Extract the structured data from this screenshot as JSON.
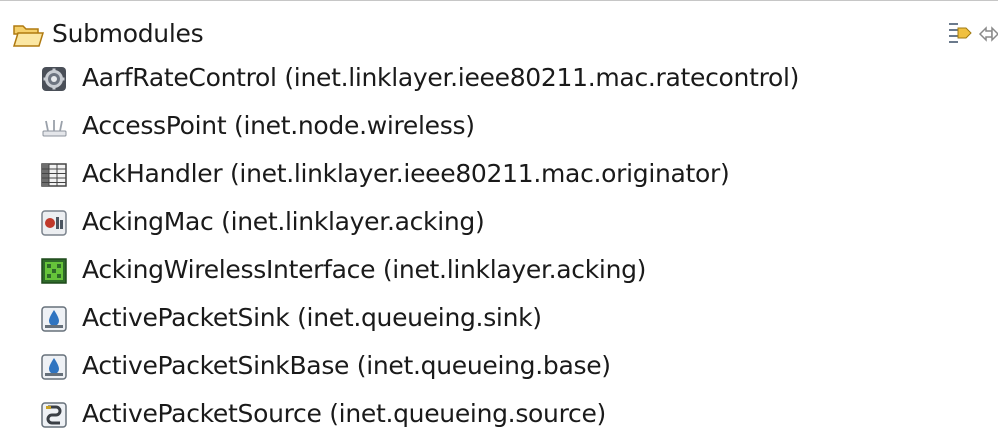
{
  "header": {
    "label": "Submodules",
    "icon": "folder-open-icon",
    "collapse_icon": "collapse-all-icon",
    "link_icon": "link-with-editor-icon"
  },
  "items": [
    {
      "label": "AarfRateControl (inet.linklayer.ieee80211.mac.ratecontrol)",
      "icon": "gear-chip-icon"
    },
    {
      "label": "AccessPoint (inet.node.wireless)",
      "icon": "access-point-icon"
    },
    {
      "label": "AckHandler (inet.linklayer.ieee80211.mac.originator)",
      "icon": "table-icon"
    },
    {
      "label": "AckingMac (inet.linklayer.acking)",
      "icon": "mac-icon"
    },
    {
      "label": "AckingWirelessInterface (inet.linklayer.acking)",
      "icon": "wireless-interface-icon"
    },
    {
      "label": "ActivePacketSink (inet.queueing.sink)",
      "icon": "sink-icon"
    },
    {
      "label": "ActivePacketSinkBase (inet.queueing.base)",
      "icon": "sink-icon"
    },
    {
      "label": "ActivePacketSource (inet.queueing.source)",
      "icon": "source-icon"
    }
  ],
  "colors": {
    "text": "#1a1a1a",
    "folder": "#e8a317",
    "separator": "#c6c6c6"
  }
}
